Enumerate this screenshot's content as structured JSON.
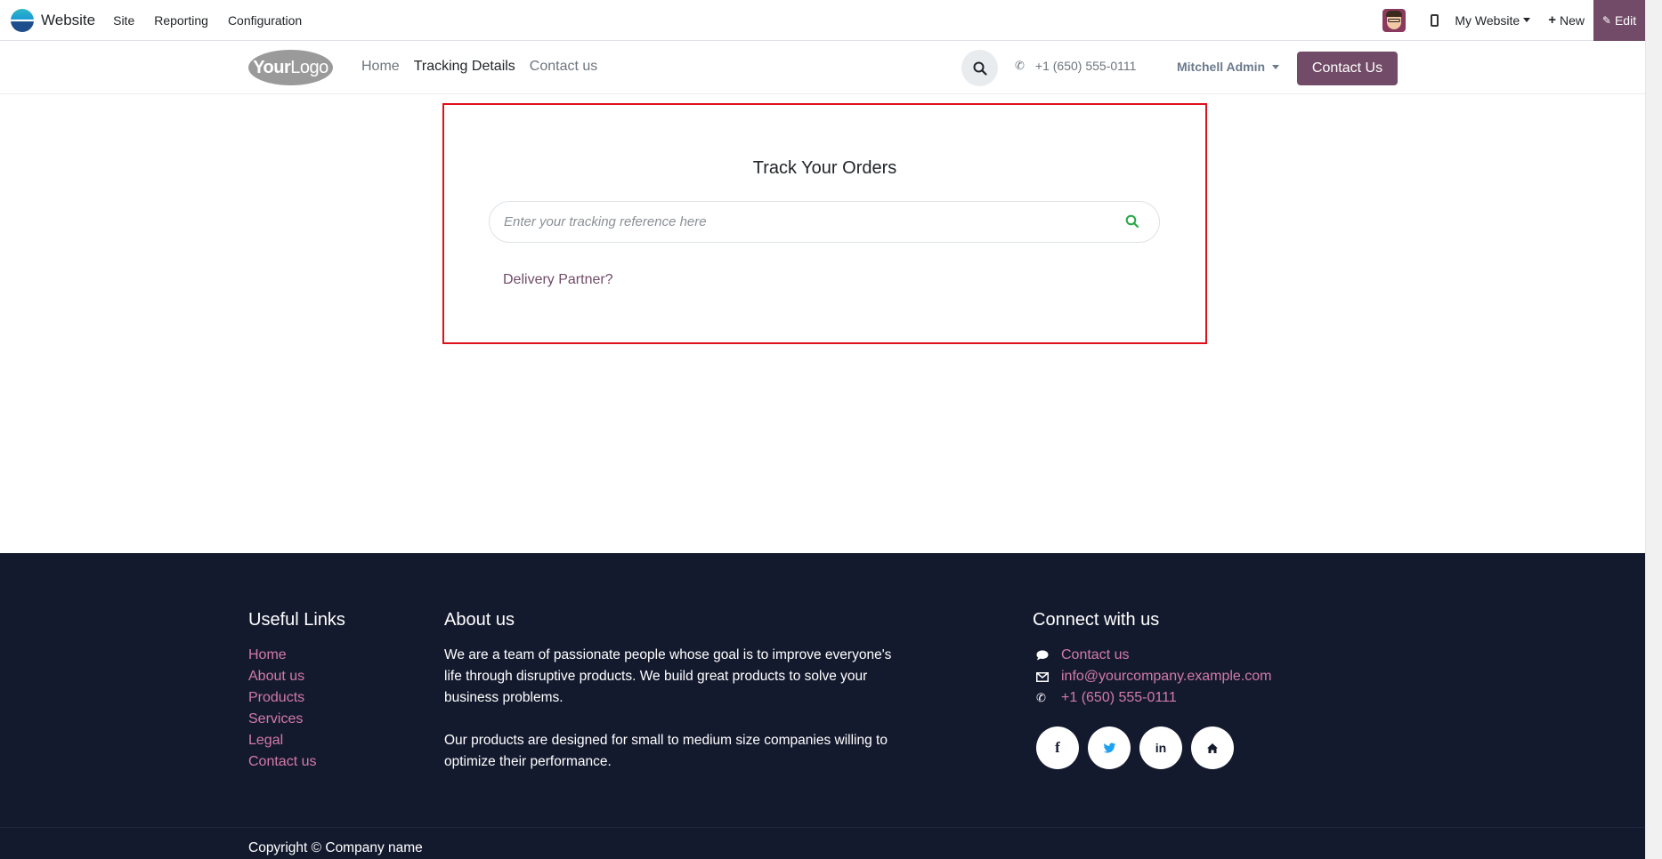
{
  "adminbar": {
    "app_name": "Website",
    "menu": [
      "Site",
      "Reporting",
      "Configuration"
    ],
    "website_selector": "My Website",
    "new_label": "New",
    "edit_label": "Edit"
  },
  "header": {
    "logo_text_bold": "Your",
    "logo_text": "Logo",
    "nav": [
      "Home",
      "Tracking Details",
      "Contact us"
    ],
    "active_nav": "Tracking Details",
    "phone": "+1 (650) 555-0111",
    "user": "Mitchell Admin",
    "cta": "Contact Us"
  },
  "tracking": {
    "title": "Track Your Orders",
    "placeholder": "Enter your tracking reference here",
    "value": "",
    "delivery_link": "Delivery Partner?"
  },
  "footer": {
    "useful_links": {
      "title": "Useful Links",
      "links": [
        "Home",
        "About us",
        "Products",
        "Services",
        "Legal",
        "Contact us"
      ]
    },
    "about": {
      "title": "About us",
      "p1": "We are a team of passionate people whose goal is to improve everyone's life through disruptive products. We build great products to solve your business problems.",
      "p2": "Our products are designed for small to medium size companies willing to optimize their performance."
    },
    "connect": {
      "title": "Connect with us",
      "contact": "Contact us",
      "email": "info@yourcompany.example.com",
      "phone": "+1 (650) 555-0111",
      "socials": [
        "facebook-icon",
        "twitter-icon",
        "linkedin-icon",
        "home-icon"
      ]
    },
    "copyright": "Copyright © Company name"
  },
  "colors": {
    "brand": "#714b67",
    "footer_bg": "#141a2e",
    "footer_link": "#d27aa8",
    "highlight_border": "#e0101a",
    "search_icon": "#28a745"
  }
}
